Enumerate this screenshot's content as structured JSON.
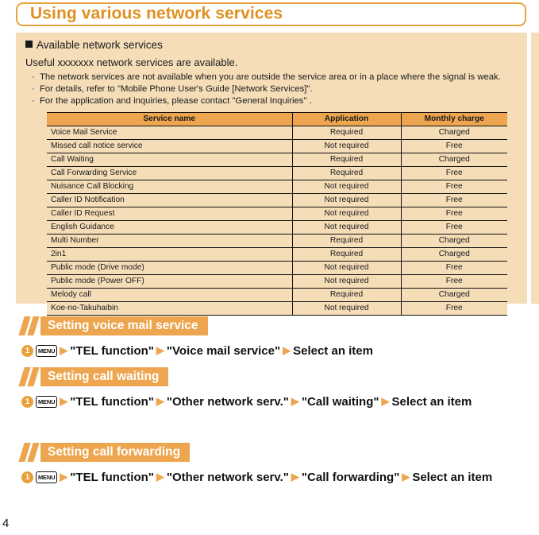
{
  "title": "Using various network services",
  "info": {
    "section_heading": "Available network services",
    "intro": "Useful xxxxxxx network services are available.",
    "bullets": [
      "The network services are not available when you are outside the service area or in a place where the signal is weak.",
      "For details, refer to \"Mobile Phone User's Guide [Network Services]\".",
      "For the application and inquiries, please contact \"General Inquiries\" ."
    ],
    "table": {
      "columns": [
        "Service name",
        "Application",
        "Monthly charge"
      ],
      "rows": [
        [
          "Voice Mail Service",
          "Required",
          "Charged"
        ],
        [
          "Missed call notice service",
          "Not required",
          "Free"
        ],
        [
          "Call Waiting",
          "Required",
          "Charged"
        ],
        [
          "Call Forwarding Service",
          "Required",
          "Free"
        ],
        [
          "Nuisance Call Blocking",
          "Not required",
          "Free"
        ],
        [
          "Caller ID Notification",
          "Not required",
          "Free"
        ],
        [
          "Caller ID Request",
          "Not required",
          "Free"
        ],
        [
          "English Guidance",
          "Not required",
          "Free"
        ],
        [
          "Multi Number",
          "Required",
          "Charged"
        ],
        [
          "2in1",
          "Required",
          "Charged"
        ],
        [
          "Public mode (Drive mode)",
          "Not required",
          "Free"
        ],
        [
          "Public mode (Power OFF)",
          "Not required",
          "Free"
        ],
        [
          "Melody call",
          "Required",
          "Charged"
        ],
        [
          "Koe-no-Takuhaibin",
          "Not required",
          "Free"
        ]
      ]
    }
  },
  "procedures": [
    {
      "heading": "Setting voice mail service",
      "step_number": "1",
      "key_label": "MENU",
      "parts": [
        "\"TEL function\"",
        "\"Voice mail service\"",
        "Select an item"
      ]
    },
    {
      "heading": "Setting call waiting",
      "step_number": "1",
      "key_label": "MENU",
      "parts": [
        "\"TEL function\"",
        "\"Other network serv.\"",
        "\"Call waiting\"",
        "Select an item"
      ]
    },
    {
      "heading": "Setting call forwarding",
      "step_number": "1",
      "key_label": "MENU",
      "parts": [
        "\"TEL function\"",
        "\"Other network serv.\"",
        "\"Call forwarding\"",
        "Select an item"
      ]
    }
  ],
  "arrow_glyph": "▶",
  "page_number": "4",
  "colors": {
    "accent": "#e09020",
    "bar": "#eda64f",
    "panel": "#f5ddb8"
  }
}
